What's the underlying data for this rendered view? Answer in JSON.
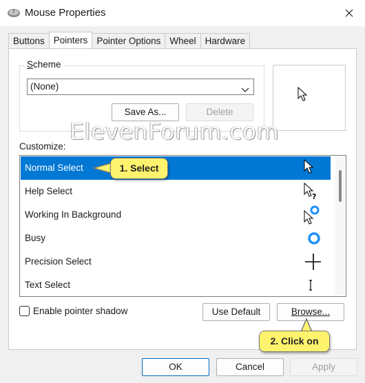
{
  "window": {
    "title": "Mouse Properties",
    "close_label": "✕"
  },
  "tabs": [
    {
      "label": "Buttons"
    },
    {
      "label": "Pointers",
      "active": true
    },
    {
      "label": "Pointer Options"
    },
    {
      "label": "Wheel"
    },
    {
      "label": "Hardware"
    }
  ],
  "scheme": {
    "label": "Scheme",
    "selected": "(None)",
    "save_as": "Save As...",
    "delete": "Delete"
  },
  "watermark": "ElevenForum.com",
  "customize": {
    "label": "Customize:",
    "items": [
      {
        "label": "Normal Select",
        "cursor": "arrow-icon",
        "selected": true
      },
      {
        "label": "Help Select",
        "cursor": "help-arrow-icon"
      },
      {
        "label": "Working In Background",
        "cursor": "working-arrow-icon"
      },
      {
        "label": "Busy",
        "cursor": "busy-ring-icon"
      },
      {
        "label": "Precision Select",
        "cursor": "crosshair-icon"
      },
      {
        "label": "Text Select",
        "cursor": "ibeam-icon"
      }
    ]
  },
  "shadow_checkbox": {
    "label": "Enable pointer shadow",
    "checked": false
  },
  "buttons": {
    "use_default": "Use Default",
    "browse": "Browse..."
  },
  "callouts": {
    "select": "1. Select",
    "click_on": "2. Click on"
  },
  "footer": {
    "ok": "OK",
    "cancel": "Cancel",
    "apply": "Apply"
  },
  "colors": {
    "selection": "#0078d4",
    "callout": "#fff36d",
    "busy_ring": "#1e90ff"
  }
}
